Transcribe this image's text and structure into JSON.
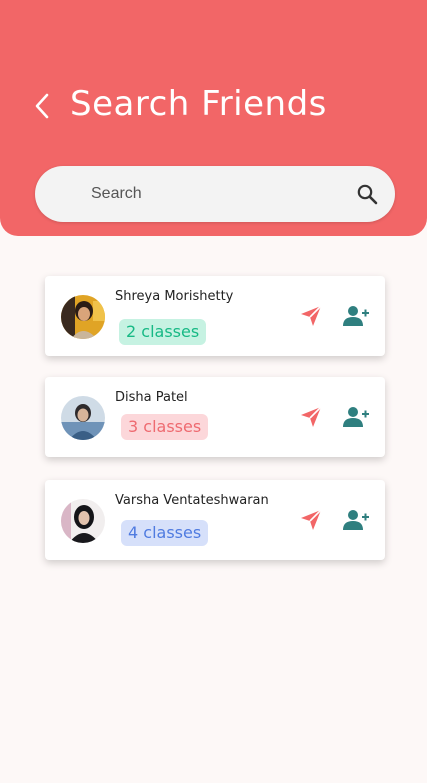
{
  "header": {
    "title": "Search Friends",
    "background_color": "#f26667",
    "back_icon": "chevron-left-icon"
  },
  "search": {
    "placeholder": "Search",
    "icon": "search-icon"
  },
  "friends": [
    {
      "name": "Shreya Morishetty",
      "classes": "2 classes",
      "badge_bg": "#c6f2e2",
      "badge_color": "#17b985",
      "avatar_colors": [
        "#3b2a22",
        "#d9b48a",
        "#e7b021"
      ]
    },
    {
      "name": "Disha Patel",
      "classes": "3 classes",
      "badge_bg": "#fcd7da",
      "badge_color": "#ee6b71",
      "avatar_colors": [
        "#7aa3c6",
        "#2c3a4c",
        "#c9d6e0"
      ]
    },
    {
      "name": "Varsha Ventateshwaran",
      "classes": "4 classes",
      "badge_bg": "#d6e0fa",
      "badge_color": "#4f7be0",
      "avatar_colors": [
        "#1b1b1f",
        "#e8d3c5",
        "#f2f2f2"
      ]
    }
  ],
  "icons": {
    "send": "send-icon",
    "add_friend": "add-friend-icon",
    "send_color": "#f26667",
    "add_color": "#2f7f7f"
  }
}
